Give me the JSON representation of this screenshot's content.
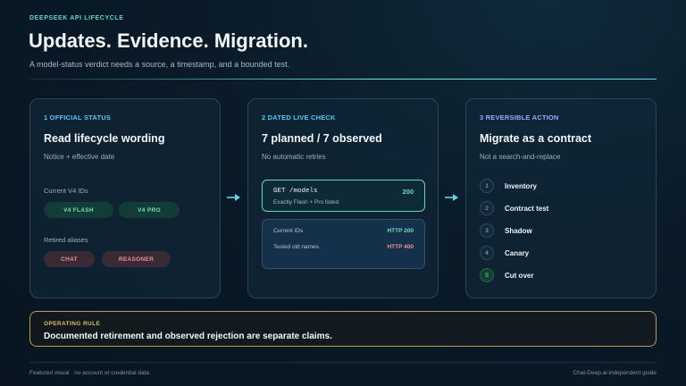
{
  "header": {
    "eyebrow": "DEEPSEEK API LIFECYCLE",
    "title": "Updates. Evidence. Migration.",
    "subtitle": "A model-status verdict needs a source, a timestamp, and a bounded test."
  },
  "cards": [
    {
      "eyebrow": "1 OFFICIAL STATUS",
      "title": "Read lifecycle wording",
      "subtitle": "Notice + effective date",
      "current_label": "Current V4 IDs",
      "current_ids": [
        "V4 FLASH",
        "V4 PRO"
      ],
      "retired_label": "Retired aliases",
      "retired_ids": [
        "CHAT",
        "REASONER"
      ]
    },
    {
      "eyebrow": "2 DATED LIVE CHECK",
      "title": "7 planned / 7 observed",
      "subtitle": "No automatic retries",
      "request": {
        "endpoint": "GET /models",
        "status": "200",
        "note": "Exactly Flash + Pro listed"
      },
      "results": [
        {
          "label": "Current IDs",
          "status": "HTTP 200"
        },
        {
          "label": "Tested old names",
          "status": "HTTP 400"
        }
      ]
    },
    {
      "eyebrow": "3 REVERSIBLE ACTION",
      "title": "Migrate as a contract",
      "subtitle": "Not a search-and-replace",
      "steps": [
        {
          "num": "1",
          "label": "Inventory"
        },
        {
          "num": "2",
          "label": "Contract test"
        },
        {
          "num": "3",
          "label": "Shadow"
        },
        {
          "num": "4",
          "label": "Canary"
        },
        {
          "num": "5",
          "label": "Cut over"
        }
      ]
    }
  ],
  "operating_rule": {
    "eyebrow": "OPERATING RULE",
    "text": "Documented retirement and observed rejection are separate claims."
  },
  "footer": {
    "left": "Featured visual · no account or credential data",
    "right": "Chat-Deep.ai independent guide"
  },
  "icons": {
    "arrow_1": "arrow-right-icon",
    "arrow_2": "arrow-right-icon"
  },
  "colors": {
    "accent_teal": "#5fd6d0",
    "accent_blue": "#56c7f0",
    "accent_violet": "#9fa6ff",
    "success": "#6fe0b4",
    "error": "#f08f99",
    "gold": "#e0bd5a"
  }
}
